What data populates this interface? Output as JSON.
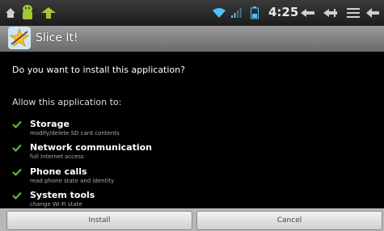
{
  "status_bar": {
    "time": "4:25",
    "icons": [
      "home-icon",
      "android-debug-icon",
      "download-icon",
      "wifi-icon",
      "signal-icon",
      "battery-icon",
      "volume-down-icon",
      "volume-up-icon",
      "menu-icon",
      "back-icon"
    ]
  },
  "title_bar": {
    "app_name": "Slice It!"
  },
  "dialog": {
    "question": "Do you want to install this application?",
    "allow_heading": "Allow this application to:",
    "permissions": [
      {
        "title": "Storage",
        "description": "modify/delete SD card contents"
      },
      {
        "title": "Network communication",
        "description": "full Internet access"
      },
      {
        "title": "Phone calls",
        "description": "read phone state and identity"
      },
      {
        "title": "System tools",
        "description": "change Wi-Fi state"
      }
    ]
  },
  "buttons": {
    "install": "Install",
    "cancel": "Cancel"
  },
  "colors": {
    "check": "#5dbb2f",
    "status_icons": "#4fc3f7"
  }
}
